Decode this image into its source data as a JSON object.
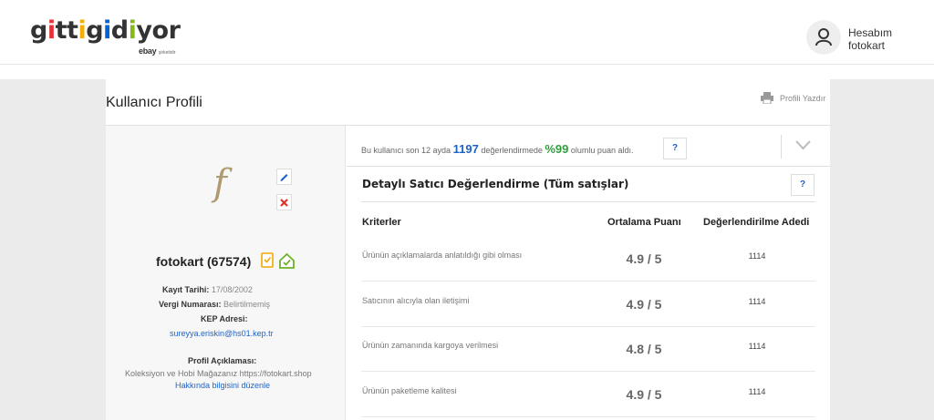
{
  "brand": {
    "logo_letters": [
      "g",
      "i",
      "t",
      "t",
      "i",
      "g",
      "i",
      "d",
      "i",
      "y",
      "o",
      "r"
    ],
    "logo_colors": [
      "#333333",
      "#e53238",
      "#333333",
      "#333333",
      "#f5af02",
      "#333333",
      "#0064d2",
      "#333333",
      "#86b817",
      "#333333",
      "#333333",
      "#333333"
    ],
    "ebay_word": "ebay",
    "ebay_suffix": "şirketidir"
  },
  "account": {
    "icon": "user-icon",
    "title": "Hesabım",
    "username": "fotokart"
  },
  "page": {
    "title": "Kullanıcı Profili",
    "print_label": "Profili Yazdır"
  },
  "profile": {
    "name": "fotokart (67574)",
    "registration_label": "Kayıt Tarihi:",
    "registration_value": "17/08/2002",
    "tax_label": "Vergi Numarası:",
    "tax_value": "Belirtilmemiş",
    "kep_label": "KEP Adresi:",
    "kep_value": "sureyya.eriskin@hs01.kep.tr",
    "desc_label": "Profil Açıklaması:",
    "desc_value": "Koleksiyon ve Hobi Mağazanız https://fotokart.shop",
    "edit_about_link": "Hakkında bilgisini düzenle",
    "signature_glyph": "f"
  },
  "summary": {
    "pre": "Bu kullanıcı son 12 ayda",
    "count": "1197",
    "mid": "değerlendirmede",
    "percent": "%99",
    "post": "olumlu puan aldı.",
    "help": "?"
  },
  "detail": {
    "title": "Detaylı Satıcı Değerlendirme (Tüm satışlar)",
    "help": "?",
    "columns": [
      "Kriterler",
      "Ortalama Puanı",
      "Değerlendirilme Adedi"
    ],
    "rows": [
      {
        "criterion": "Ürünün açıklamalarda anlatıldığı gibi olması",
        "score": "4.9 / 5",
        "count": "1114"
      },
      {
        "criterion": "Satıcının alıcıyla olan iletişimi",
        "score": "4.9 / 5",
        "count": "1114"
      },
      {
        "criterion": "Ürünün zamanında kargoya verilmesi",
        "score": "4.8 / 5",
        "count": "1114"
      },
      {
        "criterion": "Ürünün paketleme kalitesi",
        "score": "4.9 / 5",
        "count": "1114"
      }
    ]
  }
}
